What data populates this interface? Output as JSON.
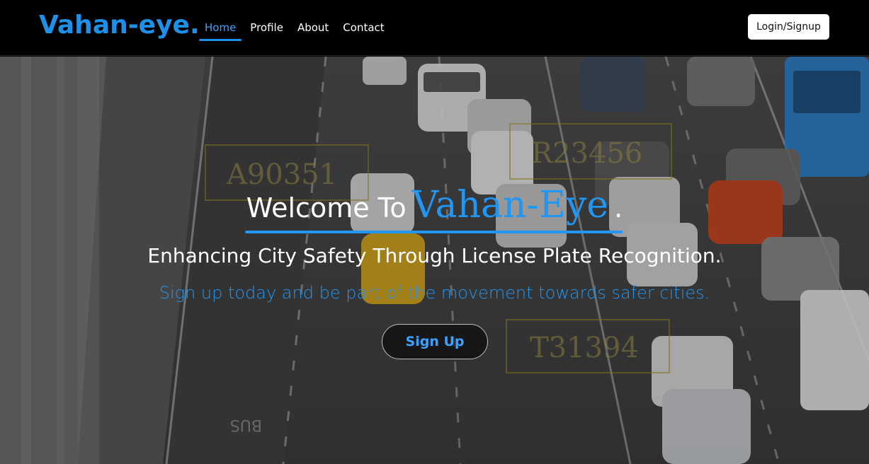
{
  "header": {
    "brand": "Vahan-eye.",
    "nav": [
      {
        "label": "Home",
        "active": true
      },
      {
        "label": "Profile",
        "active": false
      },
      {
        "label": "About",
        "active": false
      },
      {
        "label": "Contact",
        "active": false
      }
    ],
    "login_label": "Login/Signup"
  },
  "hero": {
    "welcome_prefix": "Welcome To",
    "welcome_brand": "Vahan-Eye",
    "welcome_suffix": ".",
    "tagline": "Enhancing City Safety Through License Plate Recognition.",
    "subtext": "Sign up today and be part of the movement towards safer cities.",
    "cta_label": "Sign Up",
    "background_plates": [
      "A90351",
      "R23456",
      "T31394"
    ],
    "road_marking": "BUS"
  },
  "colors": {
    "accent": "#2196f3",
    "nav_bg": "#000000",
    "text": "#ffffff"
  }
}
